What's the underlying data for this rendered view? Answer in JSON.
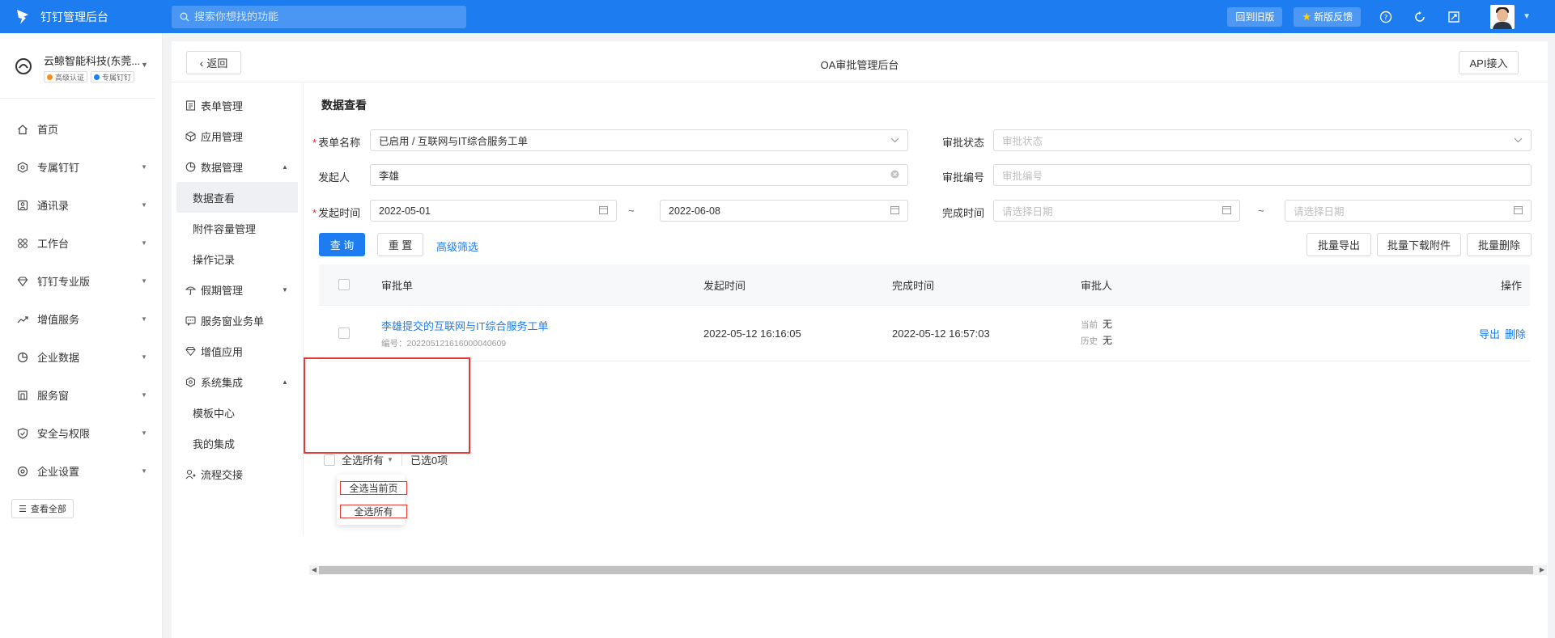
{
  "topbar": {
    "app_name": "钉钉管理后台",
    "search_placeholder": "搜索你想找的功能",
    "back_to_old": "回到旧版",
    "feedback": "新版反馈"
  },
  "org": {
    "name": "云鲸智能科技(东莞...",
    "badge_1": "高级认证",
    "badge_2": "专属钉钉"
  },
  "sidebar": {
    "items": [
      {
        "label": "首页",
        "icon": "home-icon",
        "arrow": false
      },
      {
        "label": "专属钉钉",
        "icon": "shield-icon",
        "arrow": true
      },
      {
        "label": "通讯录",
        "icon": "contacts-icon",
        "arrow": true
      },
      {
        "label": "工作台",
        "icon": "grid-icon",
        "arrow": true
      },
      {
        "label": "钉钉专业版",
        "icon": "diamond-icon",
        "arrow": true
      },
      {
        "label": "增值服务",
        "icon": "trend-icon",
        "arrow": true
      },
      {
        "label": "企业数据",
        "icon": "pie-icon",
        "arrow": true
      },
      {
        "label": "服务窗",
        "icon": "window-icon",
        "arrow": true
      },
      {
        "label": "安全与权限",
        "icon": "security-icon",
        "arrow": true
      },
      {
        "label": "企业设置",
        "icon": "settings-icon",
        "arrow": true
      }
    ],
    "view_all": "查看全部"
  },
  "panel": {
    "back": "返回",
    "title": "OA审批管理后台",
    "api": "API接入"
  },
  "subnav": {
    "form_mgmt": "表单管理",
    "app_mgmt": "应用管理",
    "data_mgmt": "数据管理",
    "data_view": "数据查看",
    "attach_mgmt": "附件容量管理",
    "op_log": "操作记录",
    "leave_mgmt": "假期管理",
    "service_orders": "服务窗业务单",
    "value_apps": "增值应用",
    "sys_integration": "系统集成",
    "template_center": "模板中心",
    "my_integration": "我的集成",
    "process_handover": "流程交接"
  },
  "filters": {
    "section_title": "数据查看",
    "form_name_label": "表单名称",
    "form_name_value": "已启用 / 互联网与IT综合服务工单",
    "status_label": "审批状态",
    "status_placeholder": "审批状态",
    "initiator_label": "发起人",
    "initiator_value": "李雄",
    "number_label": "审批编号",
    "number_placeholder": "审批编号",
    "start_time_label": "发起时间",
    "start_from": "2022-05-01",
    "start_to": "2022-06-08",
    "finish_time_label": "完成时间",
    "finish_from_placeholder": "请选择日期",
    "finish_to_placeholder": "请选择日期",
    "tilde": "~",
    "query": "查 询",
    "reset": "重 置",
    "advanced": "高级筛选",
    "batch_export": "批量导出",
    "batch_download": "批量下载附件",
    "batch_delete": "批量删除"
  },
  "table": {
    "columns": [
      "审批单",
      "发起时间",
      "完成时间",
      "审批人",
      "操作"
    ],
    "rows": [
      {
        "title": "李雄提交的互联网与IT综合服务工单",
        "code": "编号：202205121616000040609",
        "start": "2022-05-12 16:16:05",
        "finish": "2022-05-12 16:57:03",
        "current_key": "当前",
        "current_val": "无",
        "history_key": "历史",
        "history_val": "无",
        "export": "导出",
        "delete": "删除"
      }
    ]
  },
  "footer": {
    "select_all": "全选所有",
    "selected": "已选0项",
    "opt_page": "全选当前页",
    "opt_all": "全选所有"
  },
  "colors": {
    "brand": "#1c7cf0",
    "highlight": "#e53935"
  }
}
